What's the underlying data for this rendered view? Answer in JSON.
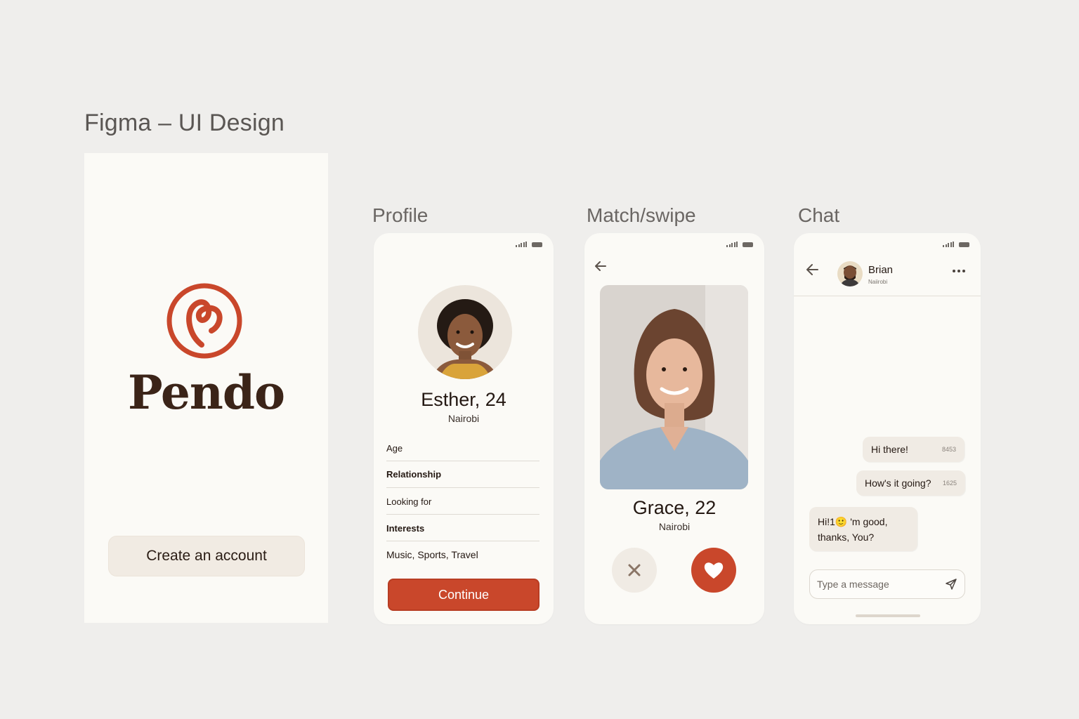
{
  "canvas": {
    "title": "Figma – UI Design"
  },
  "splash": {
    "brand": "Pendo",
    "create_account_label": "Create an account",
    "brand_color": "#c9472b"
  },
  "profile": {
    "label": "Profile",
    "name": "Esther, 24",
    "city": "Nairobi",
    "fields": [
      "Age",
      "Relationship",
      "Looking for",
      "Interests",
      "Music, Sports, Travel"
    ],
    "continue_label": "Continue"
  },
  "match": {
    "label": "Match/swipe",
    "name": "Grace, 22",
    "city": "Nairobi",
    "dislike_icon": "close-icon",
    "like_icon": "heart-icon"
  },
  "chat": {
    "label": "Chat",
    "contact_name": "Brian",
    "contact_sub": "Naiirobi",
    "messages": [
      {
        "text": "Hi there!",
        "time": "8453",
        "from": "me"
      },
      {
        "text": "How's it going?",
        "time": "1625",
        "from": "me"
      },
      {
        "text": "Hi!1🙂 'm good, thanks, You?",
        "from": "them"
      }
    ],
    "input_placeholder": "Type a message"
  },
  "colors": {
    "accent": "#c9472b",
    "background": "#efeeec",
    "surface": "#fbfaf6"
  }
}
